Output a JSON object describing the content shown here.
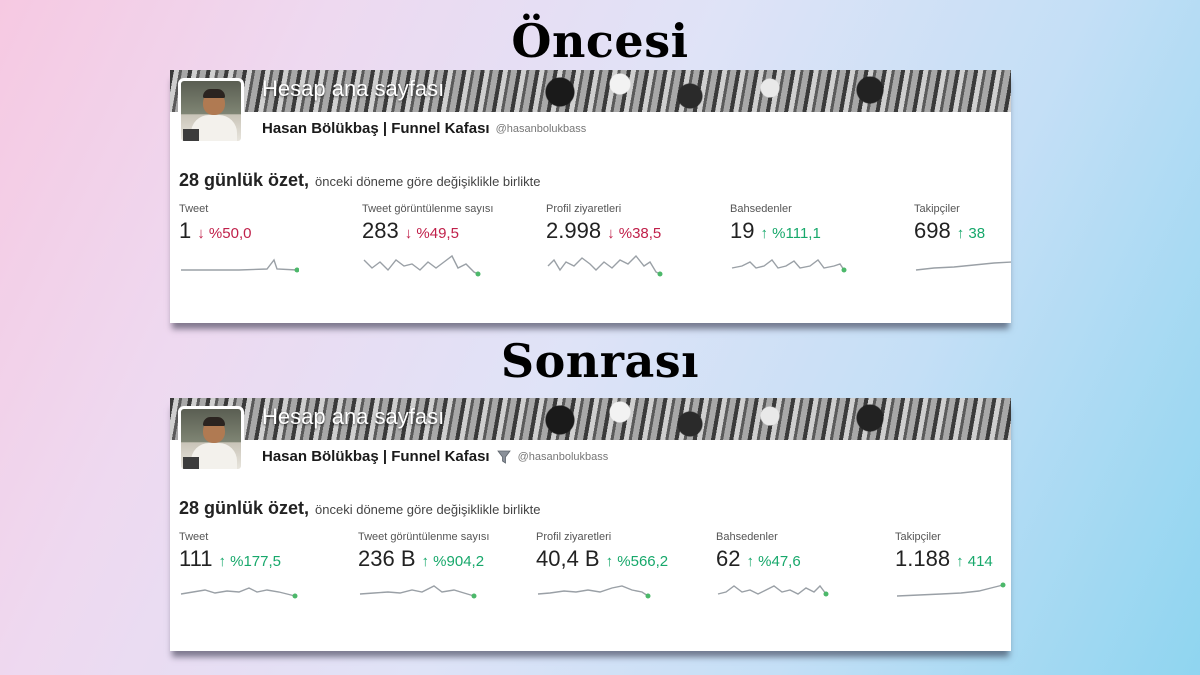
{
  "headings": {
    "before": "Öncesi",
    "after": "Sonrası"
  },
  "colors": {
    "down": "#c0204a",
    "up": "#17a86b",
    "sparkline": "#9aa0a6",
    "dot": "#4cb86a"
  },
  "before": {
    "banner_title": "Hesap ana sayfası",
    "account_name": "Hasan Bölükbaş | Funnel Kafası",
    "handle": "@hasanbolukbass",
    "summary_title": "28 günlük özet,",
    "summary_sub": "önceki döneme göre değişiklikle birlikte",
    "metrics": [
      {
        "label": "Tweet",
        "value": "1",
        "change": "↓ %50,0",
        "direction": "down"
      },
      {
        "label": "Tweet görüntülenme sayısı",
        "value": "283",
        "change": "↓ %49,5",
        "direction": "down"
      },
      {
        "label": "Profil ziyaretleri",
        "value": "2.998",
        "change": "↓ %38,5",
        "direction": "down"
      },
      {
        "label": "Bahsedenler",
        "value": "19",
        "change": "↑ %111,1",
        "direction": "up"
      },
      {
        "label": "Takipçiler",
        "value": "698",
        "change": "↑ 38",
        "direction": "up"
      }
    ]
  },
  "after": {
    "banner_title": "Hesap ana sayfası",
    "account_name": "Hasan Bölükbaş | Funnel Kafası",
    "badge_icon": "funnel-icon",
    "handle": "@hasanbolukbass",
    "summary_title": "28 günlük özet,",
    "summary_sub": "önceki döneme göre değişiklikle birlikte",
    "metrics": [
      {
        "label": "Tweet",
        "value": "111",
        "change": "↑ %177,5",
        "direction": "up"
      },
      {
        "label": "Tweet görüntülenme sayısı",
        "value": "236 B",
        "change": "↑ %904,2",
        "direction": "up"
      },
      {
        "label": "Profil ziyaretleri",
        "value": "40,4 B",
        "change": "↑ %566,2",
        "direction": "up"
      },
      {
        "label": "Bahsedenler",
        "value": "62",
        "change": "↑ %47,6",
        "direction": "up"
      },
      {
        "label": "Takipçiler",
        "value": "1.188",
        "change": "↑ 414",
        "direction": "up"
      }
    ]
  }
}
